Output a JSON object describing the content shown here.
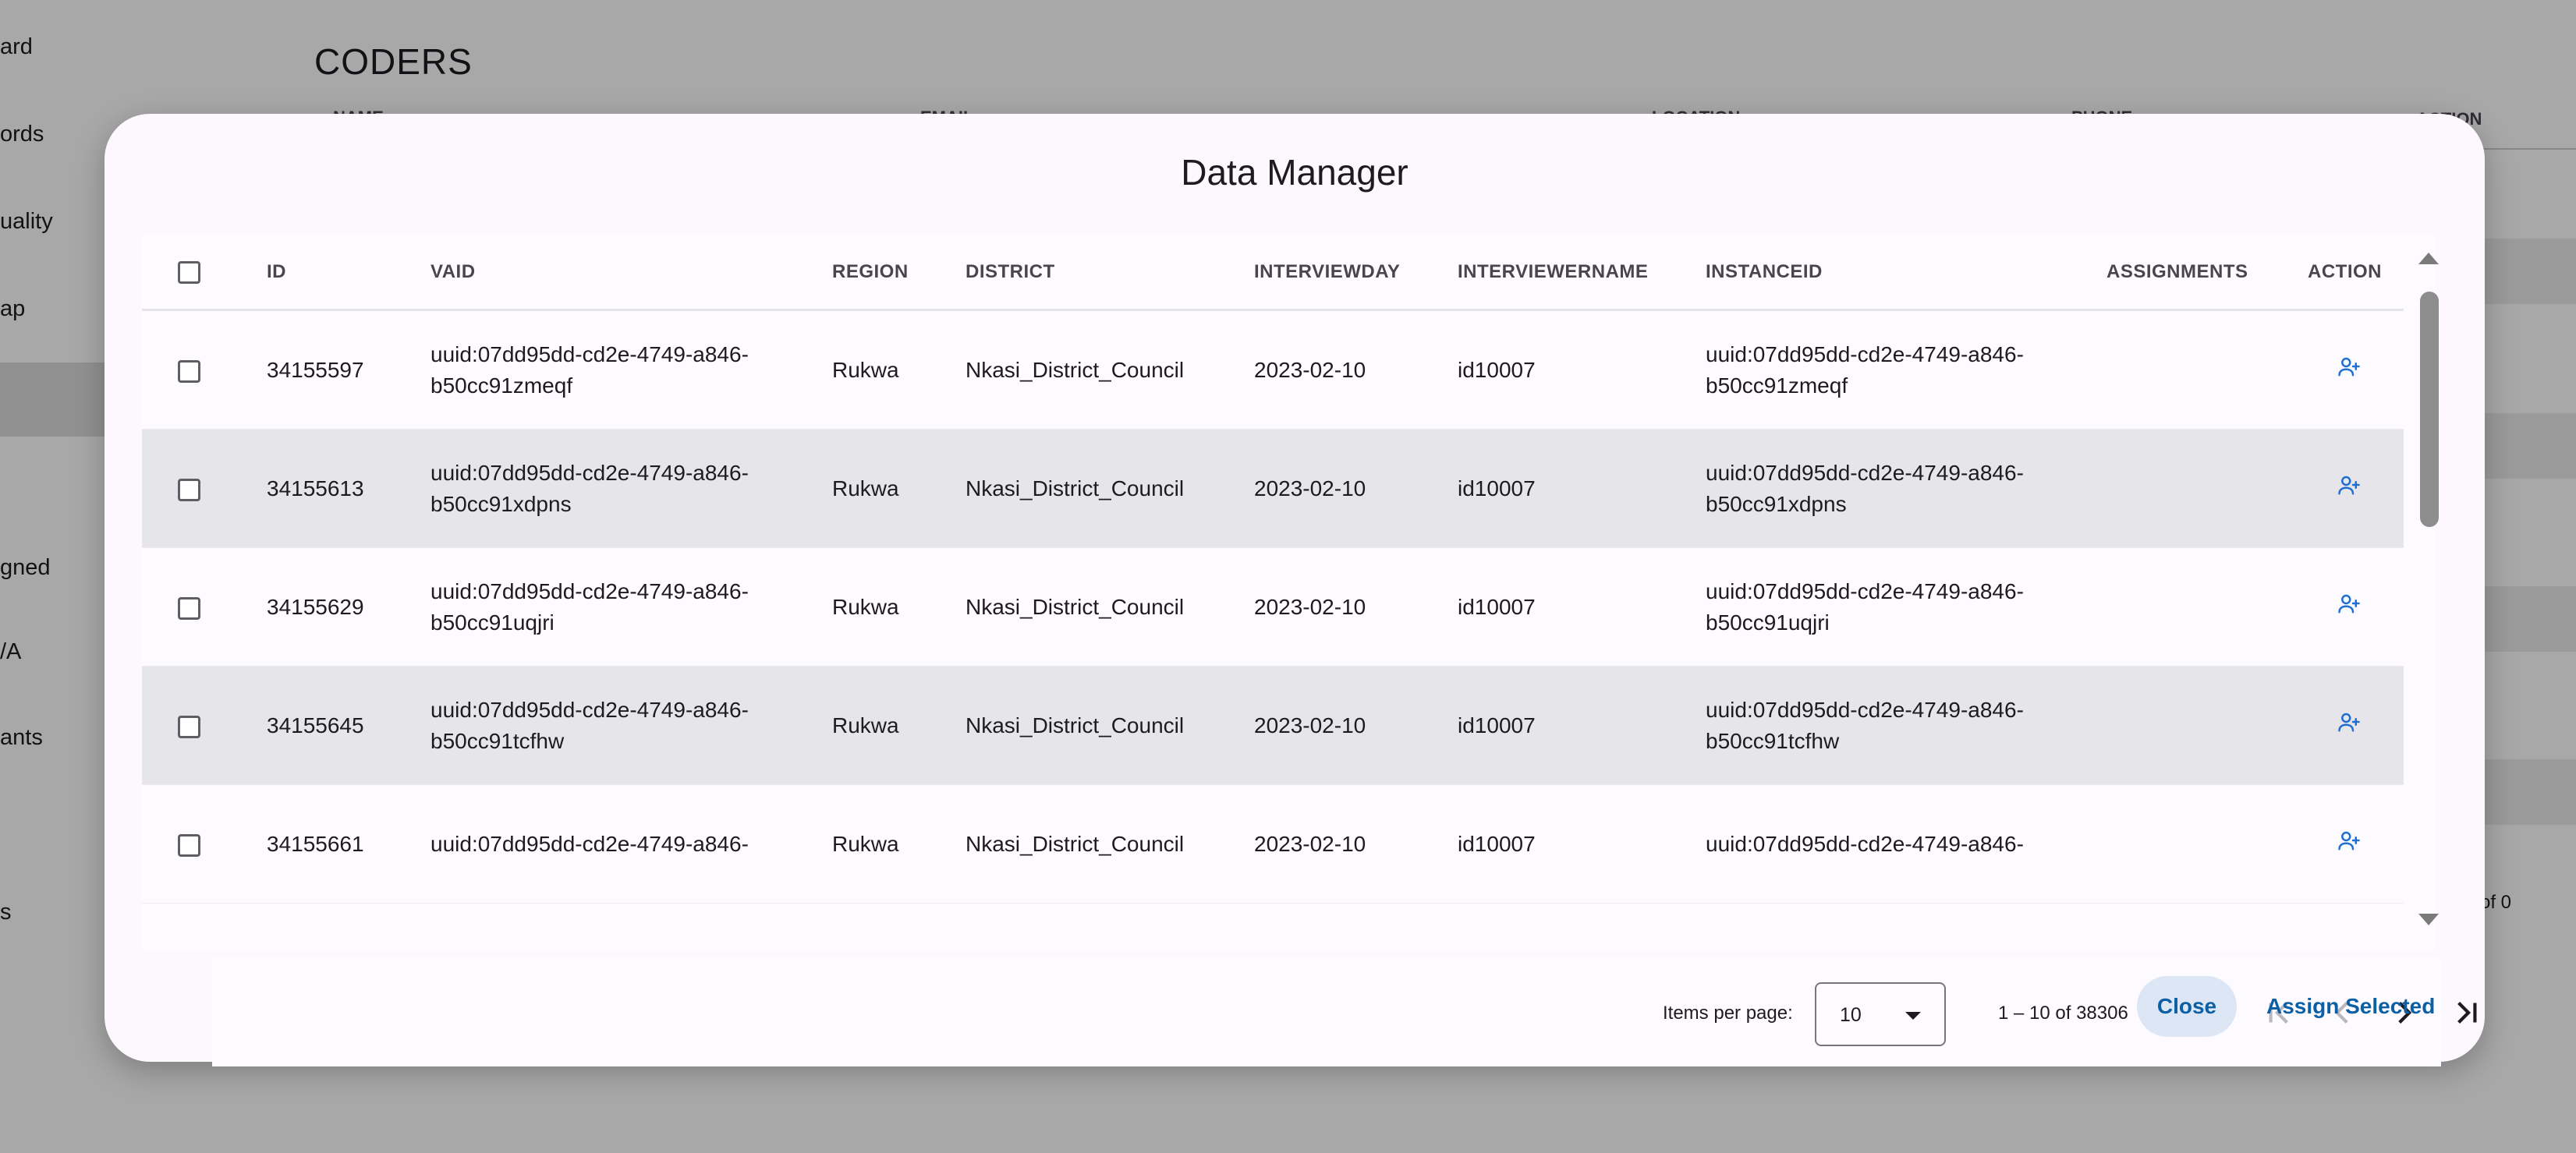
{
  "background": {
    "sidebar_items": [
      "ard",
      "ords",
      "uality",
      "ap",
      "gned",
      "/A",
      "ants",
      "s"
    ],
    "page_title": "CODERS",
    "table_headers": [
      "NAME",
      "EMAIL",
      "LOCATION",
      "PHONE",
      "ACTION"
    ],
    "footer_text": "of 0"
  },
  "dialog": {
    "title": "Data Manager",
    "columns": [
      "ID",
      "VAID",
      "REGION",
      "DISTRICT",
      "INTERVIEWDAY",
      "INTERVIEWERNAME",
      "INSTANCEID",
      "ASSIGNMENTS",
      "ACTION"
    ],
    "rows": [
      {
        "id": "34155597",
        "vaid_line1": "uuid:07dd95dd-cd2e-4749-a846-",
        "vaid_line2": "b50cc91zmeqf",
        "region": "Rukwa",
        "district": "Nkasi_District_Council",
        "interviewday": "2023-02-10",
        "interviewername": "id10007",
        "instanceid_line1": "uuid:07dd95dd-cd2e-4749-a846-",
        "instanceid_line2": "b50cc91zmeqf",
        "assignments": ""
      },
      {
        "id": "34155613",
        "vaid_line1": "uuid:07dd95dd-cd2e-4749-a846-",
        "vaid_line2": "b50cc91xdpns",
        "region": "Rukwa",
        "district": "Nkasi_District_Council",
        "interviewday": "2023-02-10",
        "interviewername": "id10007",
        "instanceid_line1": "uuid:07dd95dd-cd2e-4749-a846-",
        "instanceid_line2": "b50cc91xdpns",
        "assignments": ""
      },
      {
        "id": "34155629",
        "vaid_line1": "uuid:07dd95dd-cd2e-4749-a846-",
        "vaid_line2": "b50cc91uqjri",
        "region": "Rukwa",
        "district": "Nkasi_District_Council",
        "interviewday": "2023-02-10",
        "interviewername": "id10007",
        "instanceid_line1": "uuid:07dd95dd-cd2e-4749-a846-",
        "instanceid_line2": "b50cc91uqjri",
        "assignments": ""
      },
      {
        "id": "34155645",
        "vaid_line1": "uuid:07dd95dd-cd2e-4749-a846-",
        "vaid_line2": "b50cc91tcfhw",
        "region": "Rukwa",
        "district": "Nkasi_District_Council",
        "interviewday": "2023-02-10",
        "interviewername": "id10007",
        "instanceid_line1": "uuid:07dd95dd-cd2e-4749-a846-",
        "instanceid_line2": "b50cc91tcfhw",
        "assignments": ""
      },
      {
        "id": "34155661",
        "vaid_line1": "uuid:07dd95dd-cd2e-4749-a846-",
        "vaid_line2": "",
        "region": "Rukwa",
        "district": "Nkasi_District_Council",
        "interviewday": "2023-02-10",
        "interviewername": "id10007",
        "instanceid_line1": "uuid:07dd95dd-cd2e-4749-a846-",
        "instanceid_line2": "",
        "assignments": ""
      }
    ],
    "paginator": {
      "items_per_page_label": "Items per page:",
      "page_size": "10",
      "range_label": "1 – 10 of 38306"
    },
    "buttons": {
      "close": "Close",
      "assign_selected": "Assign Selected"
    },
    "colors": {
      "accent": "#0b5fa5",
      "action_icon": "#1f6fd1",
      "stripe": "#e6e6ea"
    },
    "icons": {
      "action": "person-add-icon",
      "first_page": "first-page-icon",
      "prev_page": "chevron-left-icon",
      "next_page": "chevron-right-icon",
      "last_page": "last-page-icon"
    }
  }
}
